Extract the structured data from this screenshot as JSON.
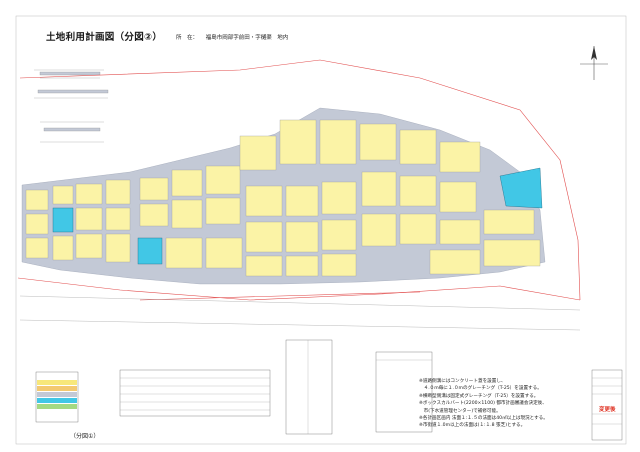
{
  "drawing": {
    "title": "土地利用計画図（分図②）",
    "location_label": "所　在：",
    "location_value": "福島市岡部字前田・字樋渠　地内",
    "subtitle": "（分図①）",
    "stamp": "変更後"
  },
  "notes": [
    "※道路側溝にはコンクリート蓋を設置し、",
    "　４.０m毎に１.０mのグレーチング（T-25）を設置する。",
    "※横断型側溝は固定式グレーチング（T-25）を設置する。",
    "※ボックスカルバート(2200×1100) 都市計画審議会決定後、",
    "　市(下水道管理センター)で補修可能。",
    "※各計画区画内 法面１:１.５の法面は40㎡以上は現況とする。",
    "※市街道１.0m以上の法面は(１:１.8 張芝)とする。"
  ],
  "colors": {
    "lot": "#fbf3a6",
    "road": "#c3c9d6",
    "park": "#41c7e6",
    "boundary": "#e14d4d",
    "stamp": "#e0392b"
  },
  "icons": {
    "north_arrow": "north-arrow-icon"
  }
}
